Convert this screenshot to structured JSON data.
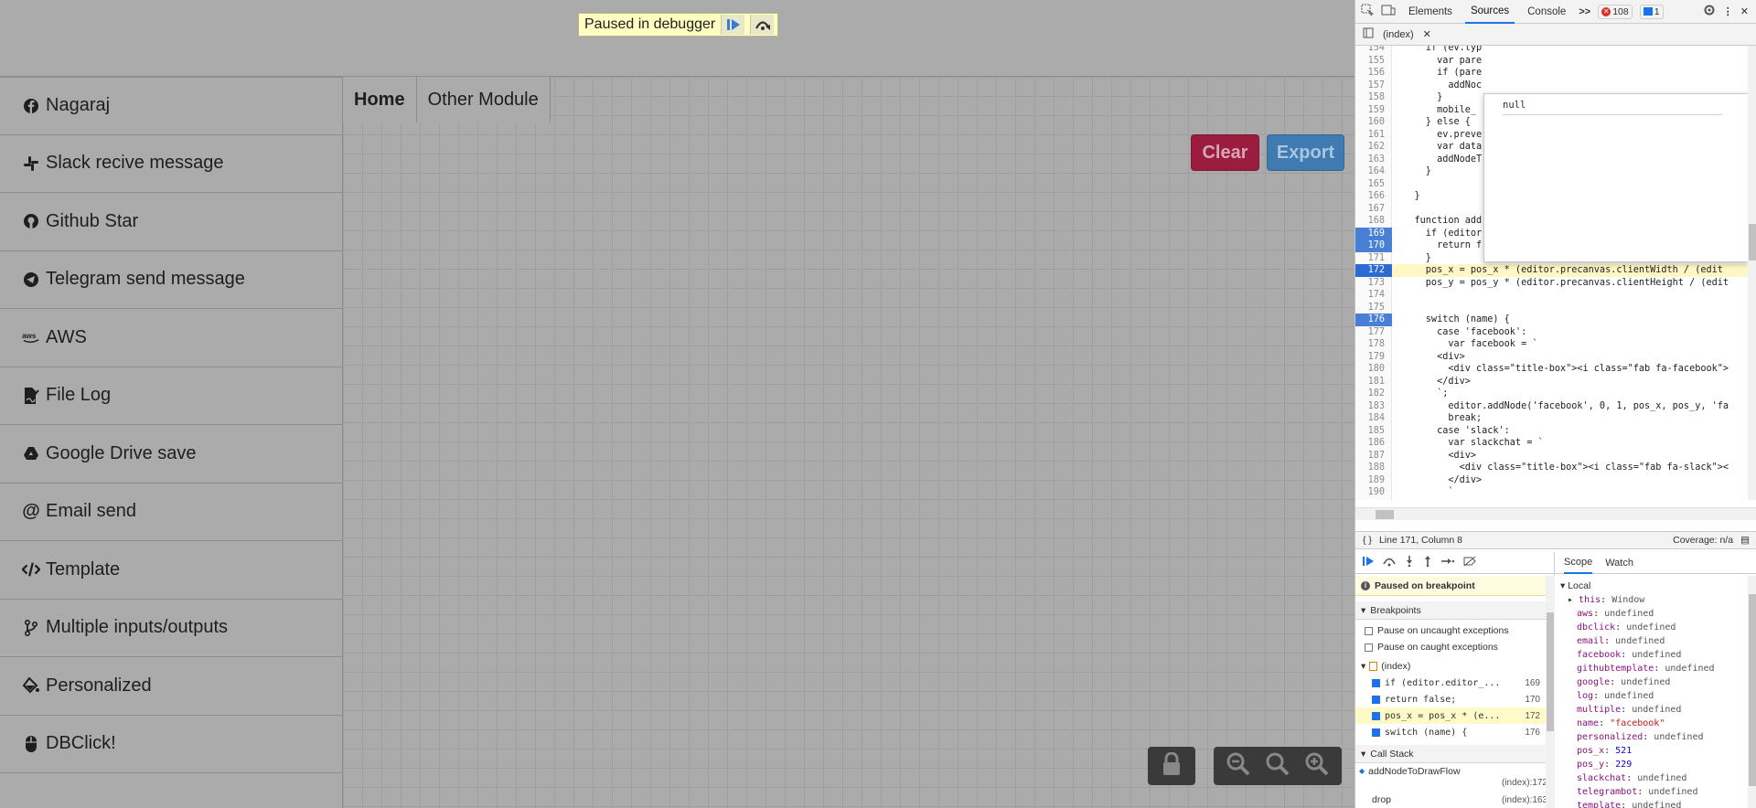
{
  "debugger_overlay": {
    "label": "Paused in debugger"
  },
  "sidebar": {
    "items": [
      {
        "label": "Nagaraj",
        "icon": "facebook-icon"
      },
      {
        "label": "Slack recive message",
        "icon": "slack-icon"
      },
      {
        "label": "Github Star",
        "icon": "github-icon"
      },
      {
        "label": "Telegram send message",
        "icon": "telegram-icon"
      },
      {
        "label": "AWS",
        "icon": "aws-icon"
      },
      {
        "label": "File Log",
        "icon": "file-signature-icon"
      },
      {
        "label": "Google Drive save",
        "icon": "google-drive-icon"
      },
      {
        "label": "Email send",
        "icon": "at-icon"
      },
      {
        "label": "Template",
        "icon": "code-icon"
      },
      {
        "label": "Multiple inputs/outputs",
        "icon": "code-branch-icon"
      },
      {
        "label": "Personalized",
        "icon": "fill-icon"
      },
      {
        "label": "DBClick!",
        "icon": "mouse-icon"
      }
    ]
  },
  "main": {
    "tabs": [
      {
        "label": "Home"
      },
      {
        "label": "Other Module"
      }
    ],
    "clear_label": "Clear",
    "export_label": "Export",
    "colors": {
      "clear": "#9c1c3f",
      "export": "#3f7ab0"
    }
  },
  "devtools": {
    "top_tabs": [
      {
        "label": "Elements"
      },
      {
        "label": "Sources"
      },
      {
        "label": "Console"
      }
    ],
    "more": ">>",
    "error_count": "108",
    "message_count": "1",
    "file_tab": "(index)",
    "popup_value": "null",
    "code_lines": [
      {
        "n": "154",
        "t": "      if (ev.typ"
      },
      {
        "n": "155",
        "t": "        var pare"
      },
      {
        "n": "156",
        "t": "        if (pare"
      },
      {
        "n": "157",
        "t": "          addNoc"
      },
      {
        "n": "158",
        "t": "        }"
      },
      {
        "n": "159",
        "t": "        mobile_"
      },
      {
        "n": "160",
        "t": "      } else {"
      },
      {
        "n": "161",
        "t": "        ev.preve"
      },
      {
        "n": "162",
        "t": "        var data"
      },
      {
        "n": "163",
        "t": "        addNodeT"
      },
      {
        "n": "164",
        "t": "      }"
      },
      {
        "n": "165",
        "t": ""
      },
      {
        "n": "166",
        "t": "    }"
      },
      {
        "n": "167",
        "t": ""
      },
      {
        "n": "168",
        "t": "    function add"
      },
      {
        "n": "169",
        "t": "      if (editor"
      },
      {
        "n": "170",
        "t": "        return f"
      },
      {
        "n": "171",
        "t": "      }"
      },
      {
        "n": "172",
        "t": "      pos_x = pos_x * (editor.precanvas.clientWidth / (edit"
      },
      {
        "n": "173",
        "t": "      pos_y = pos_y * (editor.precanvas.clientHeight / (edit"
      },
      {
        "n": "174",
        "t": ""
      },
      {
        "n": "175",
        "t": ""
      },
      {
        "n": "176",
        "t": "      switch (name) {"
      },
      {
        "n": "177",
        "t": "        case 'facebook':"
      },
      {
        "n": "178",
        "t": "          var facebook = `"
      },
      {
        "n": "179",
        "t": "        <div>"
      },
      {
        "n": "180",
        "t": "          <div class=\"title-box\"><i class=\"fab fa-facebook\">"
      },
      {
        "n": "181",
        "t": "        </div>"
      },
      {
        "n": "182",
        "t": "        `;"
      },
      {
        "n": "183",
        "t": "          editor.addNode('facebook', 0, 1, pos_x, pos_y, 'fa"
      },
      {
        "n": "184",
        "t": "          break;"
      },
      {
        "n": "185",
        "t": "        case 'slack':"
      },
      {
        "n": "186",
        "t": "          var slackchat = `"
      },
      {
        "n": "187",
        "t": "          <div>"
      },
      {
        "n": "188",
        "t": "            <div class=\"title-box\"><i class=\"fab fa-slack\"><"
      },
      {
        "n": "189",
        "t": "          </div>"
      },
      {
        "n": "190",
        "t": "          `"
      }
    ],
    "status": {
      "position": "Line 171, Column 8",
      "coverage": "Coverage: n/a"
    },
    "paused_on": "Paused on breakpoint",
    "breakpoints_header": "Breakpoints",
    "pause_uncaught": "Pause on uncaught exceptions",
    "pause_caught": "Pause on caught exceptions",
    "bp_file": "(index)",
    "breakpoints": [
      {
        "code": "if (editor.editor_...",
        "line": "169"
      },
      {
        "code": "return false;",
        "line": "170"
      },
      {
        "code": "pos_x = pos_x * (e...",
        "line": "172"
      },
      {
        "code": "switch (name) {",
        "line": "176"
      }
    ],
    "call_stack_header": "Call Stack",
    "call_stack": [
      {
        "fn": "addNodeToDrawFlow",
        "loc": "(index):172"
      },
      {
        "fn": "drop",
        "loc": "(index):163"
      }
    ],
    "scope_tabs": [
      {
        "label": "Scope"
      },
      {
        "label": "Watch"
      }
    ],
    "scope_local": "Local",
    "scope_vars": [
      {
        "k": "this",
        "v": "Window",
        "type": "obj"
      },
      {
        "k": "aws",
        "v": "undefined",
        "type": "u"
      },
      {
        "k": "dbclick",
        "v": "undefined",
        "type": "u"
      },
      {
        "k": "email",
        "v": "undefined",
        "type": "u"
      },
      {
        "k": "facebook",
        "v": "undefined",
        "type": "u"
      },
      {
        "k": "githubtemplate",
        "v": "undefined",
        "type": "u"
      },
      {
        "k": "google",
        "v": "undefined",
        "type": "u"
      },
      {
        "k": "log",
        "v": "undefined",
        "type": "u"
      },
      {
        "k": "multiple",
        "v": "undefined",
        "type": "u"
      },
      {
        "k": "name",
        "v": "\"facebook\"",
        "type": "str"
      },
      {
        "k": "personalized",
        "v": "undefined",
        "type": "u"
      },
      {
        "k": "pos_x",
        "v": "521",
        "type": "num"
      },
      {
        "k": "pos_y",
        "v": "229",
        "type": "num"
      },
      {
        "k": "slackchat",
        "v": "undefined",
        "type": "u"
      },
      {
        "k": "telegrambot",
        "v": "undefined",
        "type": "u"
      },
      {
        "k": "template",
        "v": "undefined",
        "type": "u"
      }
    ]
  }
}
